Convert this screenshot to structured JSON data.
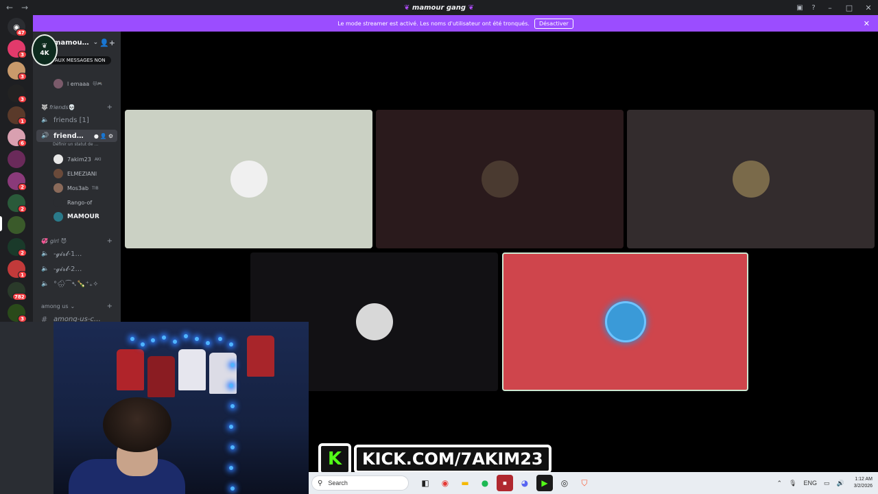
{
  "titlebar": {
    "title": "mamour gang"
  },
  "banner": {
    "message": "Le mode streamer est activé. Les noms d'utilisateur ont été tronqués.",
    "button": "Désactiver"
  },
  "rail": {
    "dm_badge": "47",
    "servers": [
      {
        "badge": "3",
        "color": "#e23a6b"
      },
      {
        "badge": "3",
        "color": "#c99a6b"
      },
      {
        "badge": "3",
        "color": "#222222"
      },
      {
        "badge": "1",
        "color": "#5a3a2a"
      },
      {
        "badge": "6",
        "color": "#d9a0b0"
      },
      {
        "badge": "",
        "color": "#6a2a5a"
      },
      {
        "badge": "2",
        "color": "#8a3a7a"
      },
      {
        "badge": "2",
        "color": "#2a5a3a"
      },
      {
        "badge": "",
        "color": "#3a5a2a"
      },
      {
        "badge": "2",
        "color": "#1a3a2a"
      },
      {
        "badge": "1",
        "color": "#c23a3a"
      },
      {
        "badge": "782",
        "color": "#2a3a2a"
      },
      {
        "badge": "3",
        "color": "#2a4a1a"
      }
    ]
  },
  "sidebar": {
    "guild_name": "mamou…",
    "logo_text": "4K",
    "tooltip": "AUX MESSAGES NON",
    "top_user": "l emaaa",
    "categories": {
      "friends": "friends",
      "girl": "girl",
      "among_us": "among us"
    },
    "channels": {
      "friends_text": "friends [1]",
      "friends_voice": "friend…",
      "status_placeholder": "Définir un statut de …",
      "girl1": "-𝓰𝓲𝓻𝓵-1…",
      "girl2": "-𝓰𝓲𝓻𝓵-2…",
      "misc": "°🌧⁀➴🍾⁺₊✧",
      "among_us_text": "among-us-c…"
    },
    "voice_users": [
      {
        "name": "7akim23",
        "tag": "AKI",
        "color": "#e8e8e8"
      },
      {
        "name": "ELMEZIANI",
        "tag": "",
        "color": "#6a4a3a"
      },
      {
        "name": "Mos3ab",
        "tag": "TIB",
        "color": "#8a6a5a"
      },
      {
        "name": "Rango-of",
        "tag": "",
        "color": "#2b2d31"
      },
      {
        "name": "MAMOUR",
        "tag": "",
        "color": "#2a7a8a"
      }
    ]
  },
  "video_tiles": [
    {
      "bg": "#cbd1c4",
      "avatar": "#f0f0f0"
    },
    {
      "bg": "#2a1a1c",
      "avatar": "#4a3a30"
    },
    {
      "bg": "#332c2d",
      "avatar": "#7a6a4a"
    },
    {
      "bg": "#121114",
      "avatar": "#d8d8d8"
    },
    {
      "bg": "#cf454c",
      "avatar": "#3a9ad8"
    }
  ],
  "kick": {
    "logo": "K",
    "url": "KICK.COM/7AKIM23"
  },
  "taskbar": {
    "search_placeholder": "Search",
    "language": "ENG",
    "time": "1:12 AM",
    "date": "3/2/2026"
  }
}
